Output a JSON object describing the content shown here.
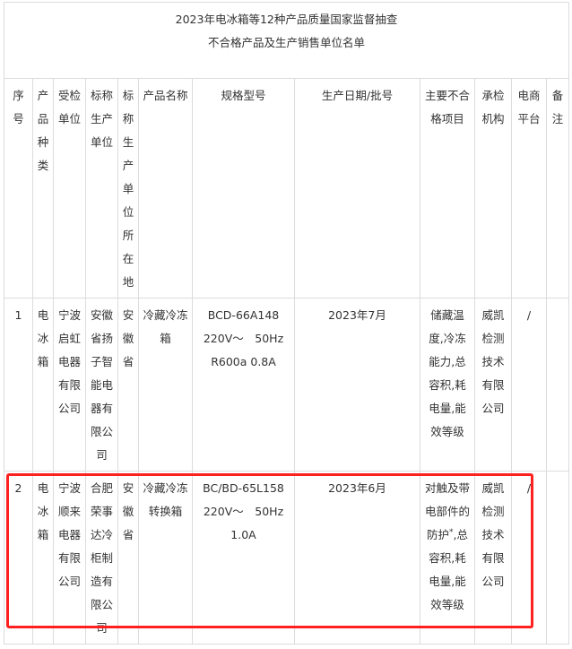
{
  "title": {
    "line1": "2023年电冰箱等12种产品质量国家监督抽查",
    "line2": "不合格产品及生产销售单位名单"
  },
  "columns": [
    "序号",
    "产品种类",
    "受检单位",
    "标称生产单位",
    "标称生产单位所在地",
    "产品名称",
    "规格型号",
    "生产日期/批号",
    "主要不合格项目",
    "承检机构",
    "电商平台",
    "备注"
  ],
  "rows": [
    {
      "no": "1",
      "category": "电冰箱",
      "inspected_unit": "宁波启虹电器有限公司",
      "producer": "安徽省扬子智能电器有限公司",
      "producer_location": "安徽省",
      "product_name": "冷藏冷冻箱",
      "spec_lines": [
        "BCD-66A148",
        "220V～　50Hz",
        "R600a 0.8A"
      ],
      "date_batch": "2023年7月",
      "defects": "储藏温度,冷冻能力,总容积,耗电量,能效等级",
      "defects_marked": "",
      "defects_rest": "",
      "lab": "威凯检测技术有限公司",
      "ecommerce": "/",
      "remark": ""
    },
    {
      "no": "2",
      "category": "电冰箱",
      "inspected_unit": "宁波顺来电器有限公司",
      "producer": "合肥荣事达冷柜制造有限公司",
      "producer_location": "安徽省",
      "product_name": "冷藏冷冻转换箱",
      "spec_lines": [
        "BC/BD-65L158",
        "220V～　50Hz",
        "1.0A"
      ],
      "date_batch": "2023年6月",
      "defects": "对触及带电部件的防护",
      "defects_marked": "*",
      "defects_rest": ",总容积,耗电量,能效等级",
      "lab": "威凯检测技术有限公司",
      "ecommerce": "/",
      "remark": ""
    }
  ],
  "highlight": {
    "row": "2",
    "color": "#ff2020"
  }
}
